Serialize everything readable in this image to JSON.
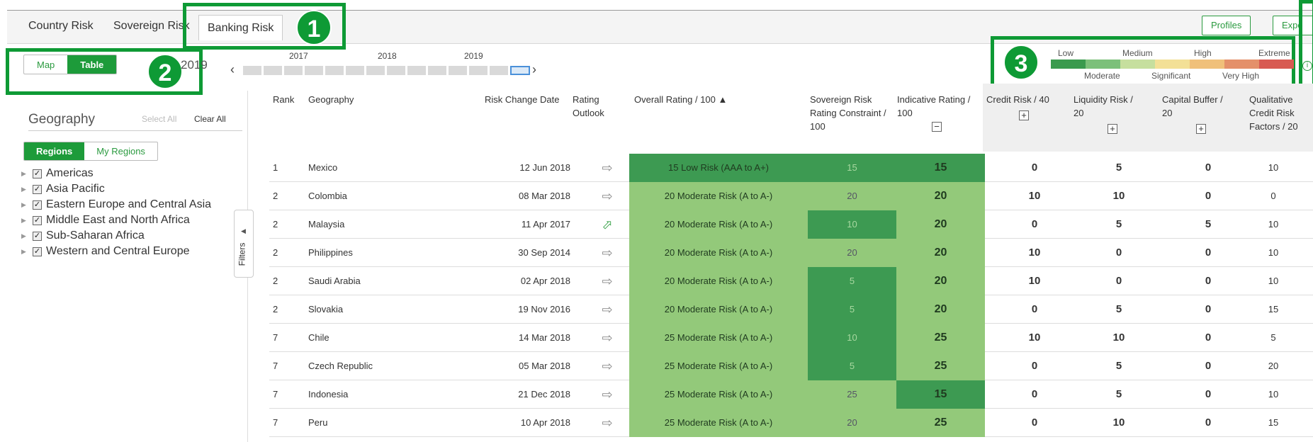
{
  "tabs": [
    {
      "label": "Country Risk"
    },
    {
      "label": "Sovereign Risk"
    },
    {
      "label": "Banking Risk"
    }
  ],
  "top_buttons": {
    "profiles": "Profiles",
    "export": "Expo"
  },
  "annotations": [
    "1",
    "2",
    "3"
  ],
  "view_toggle": {
    "map": "Map",
    "table": "Table"
  },
  "partial_year": "2019",
  "timeline": {
    "years": [
      "2017",
      "2018",
      "2019"
    ]
  },
  "legend": {
    "top_labels": [
      "Low",
      "Medium",
      "High",
      "Extreme"
    ],
    "bottom_labels": [
      "Moderate",
      "Significant",
      "Very High"
    ],
    "colors": [
      "#3a9a4e",
      "#7cc07a",
      "#c6df9e",
      "#f3e096",
      "#f0c07a",
      "#e4906a",
      "#d85a52"
    ]
  },
  "filters": {
    "geography_title": "Geography",
    "select_all": "Select All",
    "clear_all": "Clear All",
    "region_tabs": [
      "Regions",
      "My Regions"
    ],
    "regions": [
      "Americas",
      "Asia Pacific",
      "Eastern Europe and Central Asia",
      "Middle East and North Africa",
      "Sub-Saharan Africa",
      "Western and Central Europe"
    ],
    "filters_label": "Filters"
  },
  "table": {
    "headers": {
      "rank": "Rank",
      "geography": "Geography",
      "risk_change_date": "Risk Change Date",
      "rating_outlook": "Rating Outlook",
      "overall": "Overall Rating / 100 ▲",
      "sovereign": "Sovereign Risk Rating Constraint / 100",
      "indicative": "Indicative Rating / 100",
      "credit": "Credit Risk / 40",
      "liquidity": "Liquidity Risk / 20",
      "capital": "Capital Buffer / 20",
      "qualitative": "Qualitative Credit Risk Factors / 20"
    },
    "rows": [
      {
        "rank": "1",
        "geography": "Mexico",
        "date": "12 Jun 2018",
        "outlook": "⇨",
        "overall": "15 Low Risk (AAA to A+)",
        "sovereign": "15",
        "indicative": "15",
        "credit": "0",
        "liquidity": "5",
        "capital": "0",
        "qualitative": "10"
      },
      {
        "rank": "2",
        "geography": "Colombia",
        "date": "08 Mar 2018",
        "outlook": "⇨",
        "overall": "20 Moderate Risk (A to A-)",
        "sovereign": "20",
        "indicative": "20",
        "credit": "10",
        "liquidity": "10",
        "capital": "0",
        "qualitative": "0"
      },
      {
        "rank": "2",
        "geography": "Malaysia",
        "date": "11 Apr 2017",
        "outlook": "⬀",
        "overall": "20 Moderate Risk (A to A-)",
        "sovereign": "10",
        "indicative": "20",
        "credit": "0",
        "liquidity": "5",
        "capital": "5",
        "qualitative": "10"
      },
      {
        "rank": "2",
        "geography": "Philippines",
        "date": "30 Sep 2014",
        "outlook": "⇨",
        "overall": "20 Moderate Risk (A to A-)",
        "sovereign": "20",
        "indicative": "20",
        "credit": "10",
        "liquidity": "0",
        "capital": "0",
        "qualitative": "10"
      },
      {
        "rank": "2",
        "geography": "Saudi Arabia",
        "date": "02 Apr 2018",
        "outlook": "⇨",
        "overall": "20 Moderate Risk (A to A-)",
        "sovereign": "5",
        "indicative": "20",
        "credit": "10",
        "liquidity": "0",
        "capital": "0",
        "qualitative": "10"
      },
      {
        "rank": "2",
        "geography": "Slovakia",
        "date": "19 Nov 2016",
        "outlook": "⇨",
        "overall": "20 Moderate Risk (A to A-)",
        "sovereign": "5",
        "indicative": "20",
        "credit": "0",
        "liquidity": "5",
        "capital": "0",
        "qualitative": "15"
      },
      {
        "rank": "7",
        "geography": "Chile",
        "date": "14 Mar 2018",
        "outlook": "⇨",
        "overall": "25 Moderate Risk (A to A-)",
        "sovereign": "10",
        "indicative": "25",
        "credit": "10",
        "liquidity": "10",
        "capital": "0",
        "qualitative": "5"
      },
      {
        "rank": "7",
        "geography": "Czech Republic",
        "date": "05 Mar 2018",
        "outlook": "⇨",
        "overall": "25 Moderate Risk (A to A-)",
        "sovereign": "5",
        "indicative": "25",
        "credit": "0",
        "liquidity": "5",
        "capital": "0",
        "qualitative": "20"
      },
      {
        "rank": "7",
        "geography": "Indonesia",
        "date": "21 Dec 2018",
        "outlook": "⇨",
        "overall": "25 Moderate Risk (A to A-)",
        "sovereign": "25",
        "indicative": "15",
        "credit": "0",
        "liquidity": "5",
        "capital": "0",
        "qualitative": "10"
      },
      {
        "rank": "7",
        "geography": "Peru",
        "date": "10 Apr 2018",
        "outlook": "⇨",
        "overall": "25 Moderate Risk (A to A-)",
        "sovereign": "20",
        "indicative": "25",
        "credit": "0",
        "liquidity": "10",
        "capital": "0",
        "qualitative": "15"
      }
    ]
  },
  "colors": {
    "accent": "#1d9b3a",
    "dark_green": "#3d9a52",
    "light_green": "#93c97a"
  }
}
